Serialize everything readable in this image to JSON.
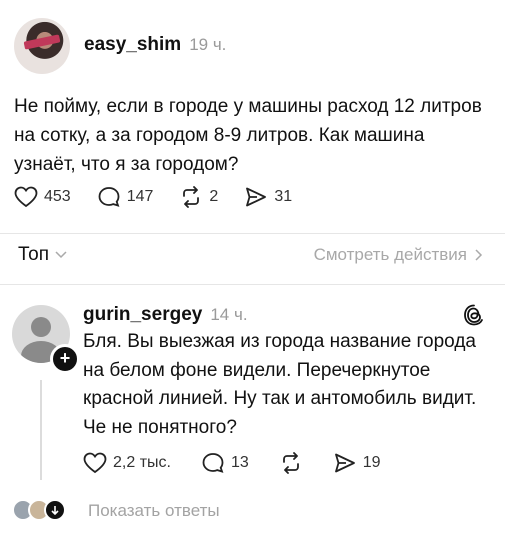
{
  "post": {
    "username": "easy_shim",
    "time": "19 ч.",
    "text": "Не пойму, если в городе у машины расход 12 литров на сотку, а за городом 8-9 литров. Как машина узнаёт, что я за городом?",
    "likes": "453",
    "comments": "147",
    "reposts": "2",
    "shares": "31"
  },
  "sort_bar": {
    "sort_label": "Топ",
    "actions_label": "Смотреть действия"
  },
  "reply": {
    "username": "gurin_sergey",
    "time": "14 ч.",
    "text": "Бля. Вы выезжая из города название города на белом фоне видели. Перечеркнутое красной линией. Ну так и антомобиль видит. Че не понятного?",
    "likes": "2,2 тыс.",
    "comments": "13",
    "shares": "19",
    "show_replies_label": "Показать ответы"
  },
  "icons": {
    "like": "heart-icon",
    "comment": "comment-bubble-icon",
    "repost": "repost-icon",
    "share": "send-icon",
    "threads": "threads-logo-icon",
    "chevron": "chevron-icon"
  }
}
